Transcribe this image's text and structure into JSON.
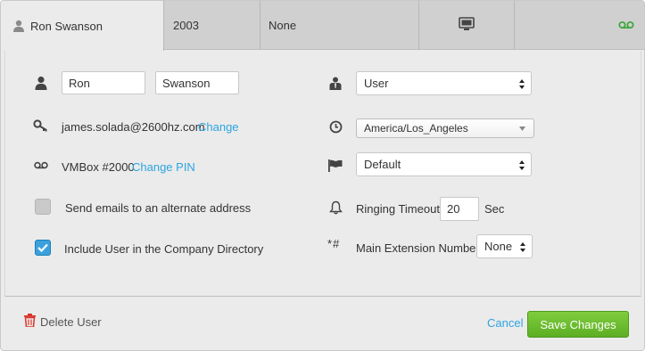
{
  "tabs": {
    "user": {
      "label": "Ron Swanson"
    },
    "extension": {
      "label": "2003"
    },
    "device": {
      "label": "None"
    },
    "screen_icon": "monitor-icon",
    "voicemail_icon": "voicemail-icon",
    "voicemail_icon_color": "#3aa63a"
  },
  "form": {
    "first_name": "Ron",
    "last_name": "Swanson",
    "email": "james.solada@2600hz.com",
    "email_change_link": "Change",
    "vmbox": "VMBox #2000",
    "change_pin_link": "Change PIN",
    "alt_email_label": "Send emails to an alternate address",
    "alt_email_checked": false,
    "directory_label": "Include User in the Company Directory",
    "directory_checked": true,
    "role_value": "User",
    "timezone_value": "America/Los_Angeles",
    "music_value": "Default",
    "ringing_timeout_label": "Ringing Timeout",
    "ringing_timeout_value": "20",
    "ringing_timeout_unit": "Sec",
    "main_ext_label": "Main Extension Number",
    "main_ext_value": "None",
    "main_ext_icon_text": "*#"
  },
  "footer": {
    "delete_label": "Delete User",
    "cancel_label": "Cancel",
    "save_label": "Save Changes"
  },
  "colors": {
    "accent_link": "#2ca5e0",
    "save_green": "#6bbd2d",
    "delete_red": "#d9342b",
    "checkbox_blue": "#3aa1dd"
  }
}
